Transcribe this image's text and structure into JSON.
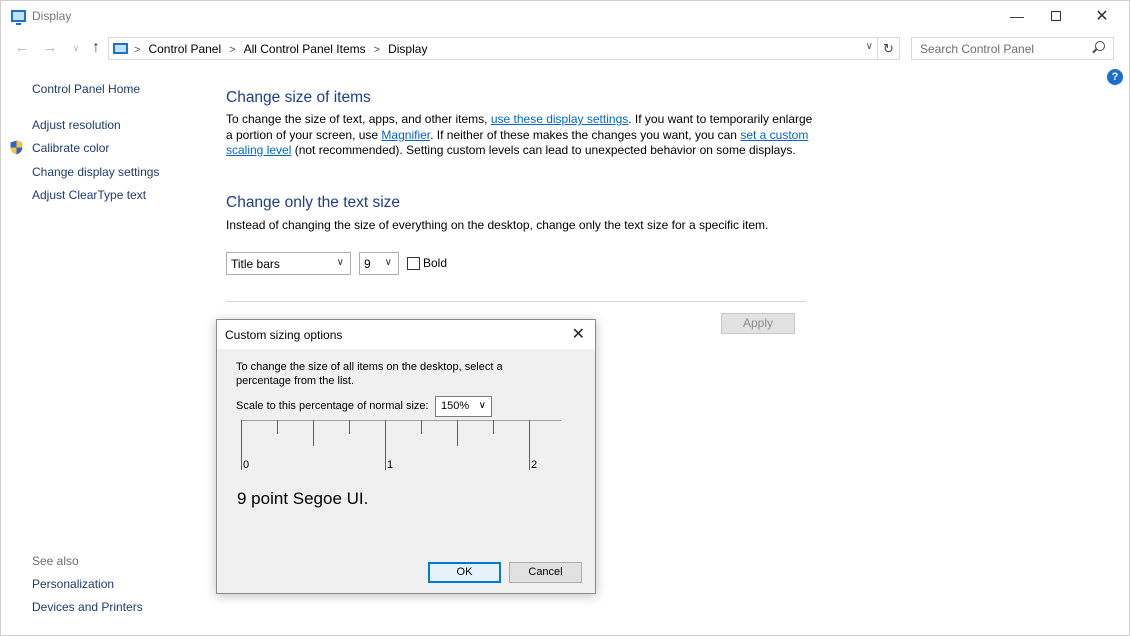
{
  "window": {
    "title": "Display",
    "minimize_glyph": "—",
    "close_glyph": "✕"
  },
  "nav": {
    "back_glyph": "←",
    "forward_glyph": "→",
    "recent_glyph": "∨",
    "up_glyph": "↑",
    "breadcrumbs": [
      "Control Panel",
      "All Control Panel Items",
      "Display"
    ],
    "separator": ">",
    "dropdown_glyph": "∨",
    "refresh_glyph": "↻",
    "search_placeholder": "Search Control Panel"
  },
  "help": {
    "glyph": "?"
  },
  "sidebar": {
    "home": "Control Panel Home",
    "items": [
      "Adjust resolution",
      "Calibrate color",
      "Change display settings",
      "Adjust ClearType text"
    ],
    "see_also_label": "See also",
    "see_also_items": [
      "Personalization",
      "Devices and Printers"
    ]
  },
  "main": {
    "section1_title": "Change size of items",
    "section1_para": {
      "t1": "To change the size of text, apps, and other items, ",
      "link1": "use these display settings",
      "t2": ".  If you want to temporarily enlarge a portion of your screen, use ",
      "link2": "Magnifier",
      "t3": ".  If neither of these makes the changes you want, you can ",
      "link3": "set a custom scaling level",
      "t4": " (not recommended).  Setting custom levels can lead to unexpected behavior on some displays."
    },
    "section2_title": "Change only the text size",
    "section2_para": "Instead of changing the size of everything on the desktop, change only the text size for a specific item.",
    "item_select": "Title bars",
    "size_select": "9",
    "bold_label": "Bold",
    "bold_checked": false,
    "apply_label": "Apply"
  },
  "dialog": {
    "title": "Custom sizing options",
    "close_glyph": "✕",
    "instructions": "To change the size of all items on the desktop, select a percentage from the list.",
    "scale_label": "Scale to this percentage of normal size:",
    "scale_value": "150%",
    "ruler_labels": [
      "0",
      "1",
      "2"
    ],
    "sample_text": "9 point Segoe UI.",
    "ok_label": "OK",
    "cancel_label": "Cancel"
  },
  "colors": {
    "link": "#0066cc",
    "heading": "#1e3d8a",
    "sidebar_link": "#1e3a70",
    "help_icon": "#1a6fd0",
    "ok_border": "#0078d7"
  }
}
